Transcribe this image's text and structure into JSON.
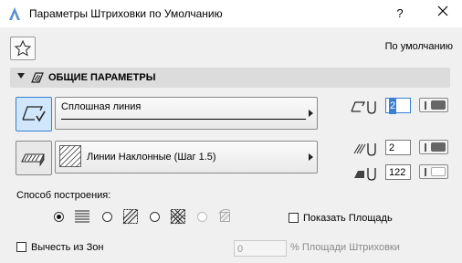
{
  "window": {
    "title": "Параметры Штриховки по Умолчанию",
    "help": "?",
    "close": "✕"
  },
  "header": {
    "default_label": "По умолчанию"
  },
  "section": {
    "title": "ОБЩИЕ ПАРАМЕТРЫ"
  },
  "line_type": {
    "label": "Сплошная линия"
  },
  "fill_type": {
    "label": "Линии Наклонные (Шаг 1.5)"
  },
  "pen_values": {
    "contour_pen": "2",
    "fill_pen": "2",
    "background_pen": "122"
  },
  "construction": {
    "label": "Способ построения:",
    "selected_option": 1,
    "show_area_label": "Показать Площадь"
  },
  "zones": {
    "subtract_label": "Вычесть из Зон",
    "percent_value": "0",
    "percent_label": "% Площади Штриховки"
  }
}
